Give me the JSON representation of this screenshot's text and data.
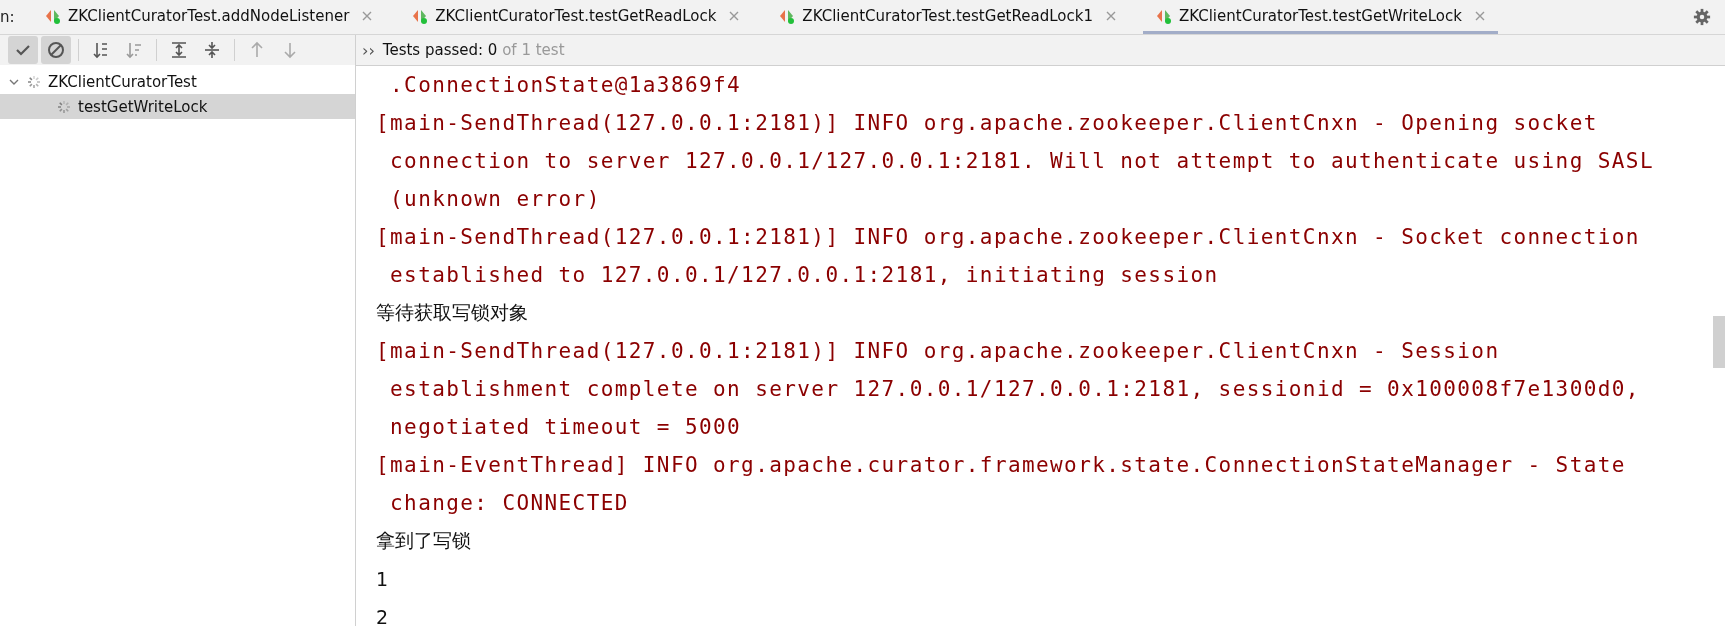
{
  "run_label": "n:",
  "tabs": [
    {
      "label": "ZKClientCuratorTest.addNodeListener",
      "selected": false
    },
    {
      "label": "ZKClientCuratorTest.testGetReadLock",
      "selected": false
    },
    {
      "label": "ZKClientCuratorTest.testGetReadLock1",
      "selected": false
    },
    {
      "label": "ZKClientCuratorTest.testGetWriteLock",
      "selected": true
    }
  ],
  "toolbar": {
    "buttons": [
      {
        "kind": "check",
        "pressed": true,
        "disabled": false
      },
      {
        "kind": "stop",
        "pressed": true,
        "disabled": false
      },
      {
        "kind": "sep"
      },
      {
        "kind": "sort-alpha",
        "pressed": false,
        "disabled": false
      },
      {
        "kind": "sort-duration",
        "pressed": false,
        "disabled": false
      },
      {
        "kind": "sep"
      },
      {
        "kind": "expand",
        "pressed": false,
        "disabled": false
      },
      {
        "kind": "collapse",
        "pressed": false,
        "disabled": false
      },
      {
        "kind": "sep"
      },
      {
        "kind": "up",
        "pressed": false,
        "disabled": true
      },
      {
        "kind": "down",
        "pressed": false,
        "disabled": true
      }
    ],
    "more": "››"
  },
  "status": {
    "label": "Tests passed:",
    "count": "0",
    "total": "of 1 test"
  },
  "tree": [
    {
      "label": "ZKClientCuratorTest",
      "expanded": true,
      "selected": false,
      "children": [
        {
          "label": "testGetWriteLock",
          "selected": true
        }
      ]
    }
  ],
  "console": [
    {
      "kind": "log",
      "lines": [
        " .ConnectionState@1a3869f4"
      ]
    },
    {
      "kind": "log",
      "lines": [
        "[main-SendThread(127.0.0.1:2181)] INFO org.apache.zookeeper.ClientCnxn - Opening socket",
        " connection to server 127.0.0.1/127.0.0.1:2181. Will not attempt to authenticate using SASL",
        " (unknown error)"
      ]
    },
    {
      "kind": "log",
      "lines": [
        "[main-SendThread(127.0.0.1:2181)] INFO org.apache.zookeeper.ClientCnxn - Socket connection",
        " established to 127.0.0.1/127.0.0.1:2181, initiating session"
      ]
    },
    {
      "kind": "out",
      "lines": [
        "等待获取写锁对象"
      ]
    },
    {
      "kind": "log",
      "lines": [
        "[main-SendThread(127.0.0.1:2181)] INFO org.apache.zookeeper.ClientCnxn - Session",
        " establishment complete on server 127.0.0.1/127.0.0.1:2181, sessionid = 0x100008f7e1300d0,",
        " negotiated timeout = 5000"
      ]
    },
    {
      "kind": "log",
      "lines": [
        "[main-EventThread] INFO org.apache.curator.framework.state.ConnectionStateManager - State",
        " change: CONNECTED"
      ]
    },
    {
      "kind": "out",
      "lines": [
        "拿到了写锁"
      ]
    },
    {
      "kind": "out",
      "lines": [
        "1"
      ]
    },
    {
      "kind": "out",
      "lines": [
        "2"
      ]
    }
  ]
}
